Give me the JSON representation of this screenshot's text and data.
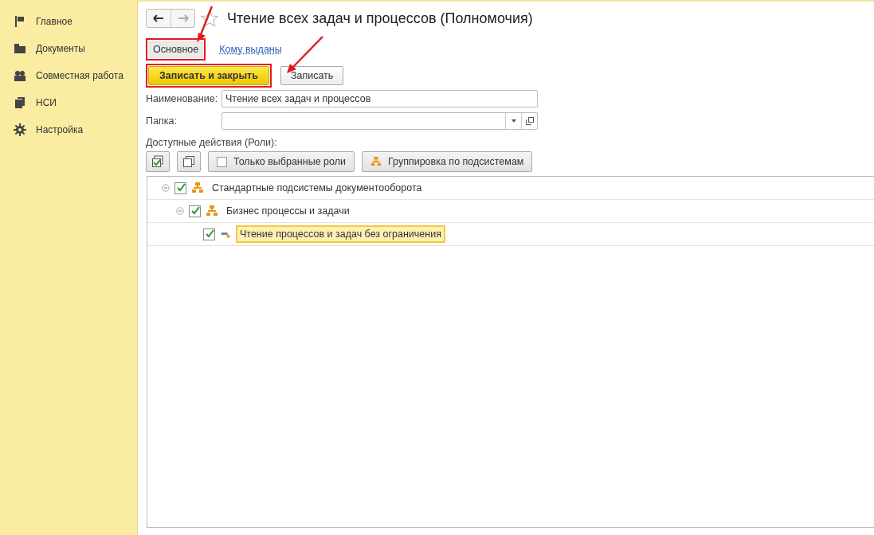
{
  "sidebar": {
    "items": [
      {
        "label": "Главное"
      },
      {
        "label": "Документы"
      },
      {
        "label": "Совместная работа"
      },
      {
        "label": "НСИ"
      },
      {
        "label": "Настройка"
      }
    ]
  },
  "form": {
    "title": "Чтение всех задач и процессов (Полномочия)",
    "favorite": false,
    "tabs": [
      {
        "label": "Основное",
        "selected": true,
        "highlighted": true
      },
      {
        "label": "Кому выданы",
        "selected": false,
        "highlighted": false
      }
    ],
    "buttons": [
      {
        "label": "Записать и закрыть",
        "kind": "primary",
        "highlighted": true
      },
      {
        "label": "Записать",
        "kind": "normal",
        "highlighted": false
      }
    ],
    "fields": [
      {
        "label": "Наименование:",
        "value": "Чтение всех задач и процессов",
        "kind": "text"
      },
      {
        "label": "Папка:",
        "kind": "select"
      }
    ],
    "roles_label": "Доступные действия (Роли):",
    "toolbar": [
      {
        "kind": "check-all"
      },
      {
        "kind": "uncheck-all"
      },
      {
        "kind": "toggle",
        "label": "Только выбранные роли",
        "checked": false
      },
      {
        "kind": "group",
        "label": "Группировка по подсистемам"
      }
    ],
    "tree": [
      {
        "label": "Стандартные подсистемы документооборота",
        "kind": "subsystem",
        "checked": true,
        "expanded": true,
        "selected": false,
        "children": [
          {
            "label": "Бизнес процессы и задачи",
            "kind": "subsystem",
            "checked": true,
            "expanded": true,
            "selected": false,
            "children": [
              {
                "label": "Чтение процессов и задач без ограничения",
                "kind": "role",
                "checked": true,
                "selected": true
              }
            ]
          }
        ]
      }
    ]
  }
}
